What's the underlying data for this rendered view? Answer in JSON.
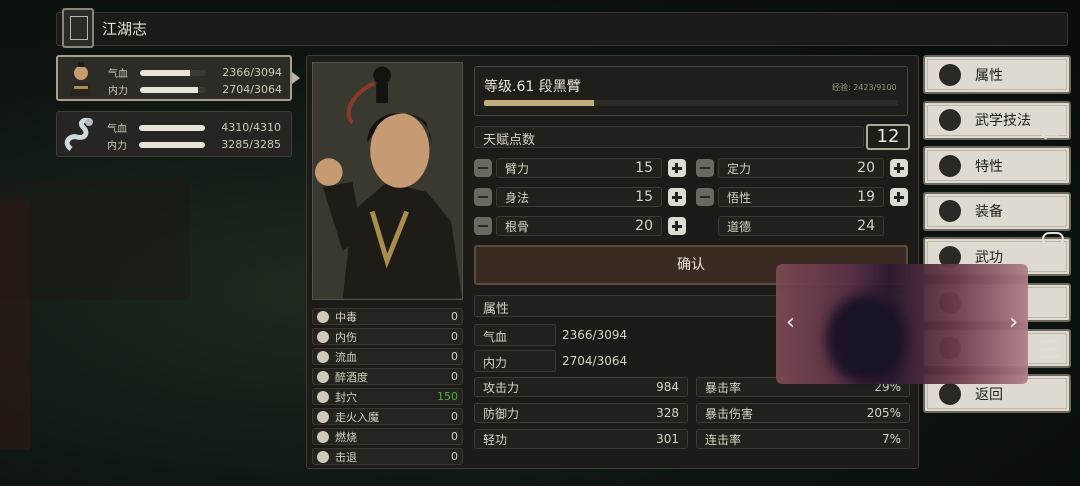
{
  "header": {
    "title": "江湖志"
  },
  "party": [
    {
      "hp_label": "气血",
      "hp": "2366/3094",
      "hp_ratio": 0.765,
      "mp_label": "内力",
      "mp": "2704/3064",
      "mp_ratio": 0.883,
      "selected": true
    },
    {
      "hp_label": "气血",
      "hp": "4310/4310",
      "hp_ratio": 1.0,
      "mp_label": "内力",
      "mp": "3285/3285",
      "mp_ratio": 1.0,
      "selected": false
    }
  ],
  "character": {
    "level_name": "等级.61  段黑臂",
    "exp_text": "经验: 2423/9100",
    "exp_ratio": 0.266,
    "talent_label": "天赋点数",
    "talent_value": "12"
  },
  "stats": [
    {
      "name": "臂力",
      "value": "15",
      "minus": true,
      "plus": true
    },
    {
      "name": "定力",
      "value": "20",
      "minus": true,
      "plus": true
    },
    {
      "name": "身法",
      "value": "15",
      "minus": true,
      "plus": true
    },
    {
      "name": "悟性",
      "value": "19",
      "minus": true,
      "plus": true
    },
    {
      "name": "根骨",
      "value": "20",
      "minus": true,
      "plus": true
    },
    {
      "name": "道德",
      "value": "24",
      "minus": false,
      "plus": false
    }
  ],
  "confirm_label": "确认",
  "attributes": {
    "header": "属性",
    "hp_label": "气血",
    "hp": "2366/3094",
    "mp_label": "内力",
    "mp": "2704/3064",
    "combat": [
      {
        "name": "攻击力",
        "value": "984"
      },
      {
        "name": "暴击率",
        "value": "29%"
      },
      {
        "name": "防御力",
        "value": "328"
      },
      {
        "name": "暴击伤害",
        "value": "205%"
      },
      {
        "name": "轻功",
        "value": "301"
      },
      {
        "name": "连击率",
        "value": "7%"
      }
    ]
  },
  "status_effects": [
    {
      "name": "中毒",
      "value": "0",
      "highlight": false
    },
    {
      "name": "内伤",
      "value": "0",
      "highlight": false
    },
    {
      "name": "流血",
      "value": "0",
      "highlight": false
    },
    {
      "name": "醉酒度",
      "value": "0",
      "highlight": false
    },
    {
      "name": "封穴",
      "value": "150",
      "highlight": true
    },
    {
      "name": "走火入魔",
      "value": "0",
      "highlight": false
    },
    {
      "name": "燃烧",
      "value": "0",
      "highlight": false
    },
    {
      "name": "击退",
      "value": "0",
      "highlight": false
    }
  ],
  "side_menu": [
    {
      "label": "属性",
      "icon": "person-icon"
    },
    {
      "label": "武学技法",
      "icon": "skill-icon"
    },
    {
      "label": "特性",
      "icon": "trait-icon"
    },
    {
      "label": "装备",
      "icon": "sword-icon"
    },
    {
      "label": "武功",
      "icon": "book-icon"
    },
    {
      "label": "",
      "icon": "blank-icon"
    },
    {
      "label": "",
      "icon": "blank-icon"
    },
    {
      "label": "返回",
      "icon": "exit-icon"
    }
  ],
  "colors": {
    "accent": "#bfae7c",
    "highlight": "#4caf3a",
    "menu_bg": "#dedad0"
  },
  "popup_nav": {
    "prev": "‹",
    "next": "›"
  }
}
